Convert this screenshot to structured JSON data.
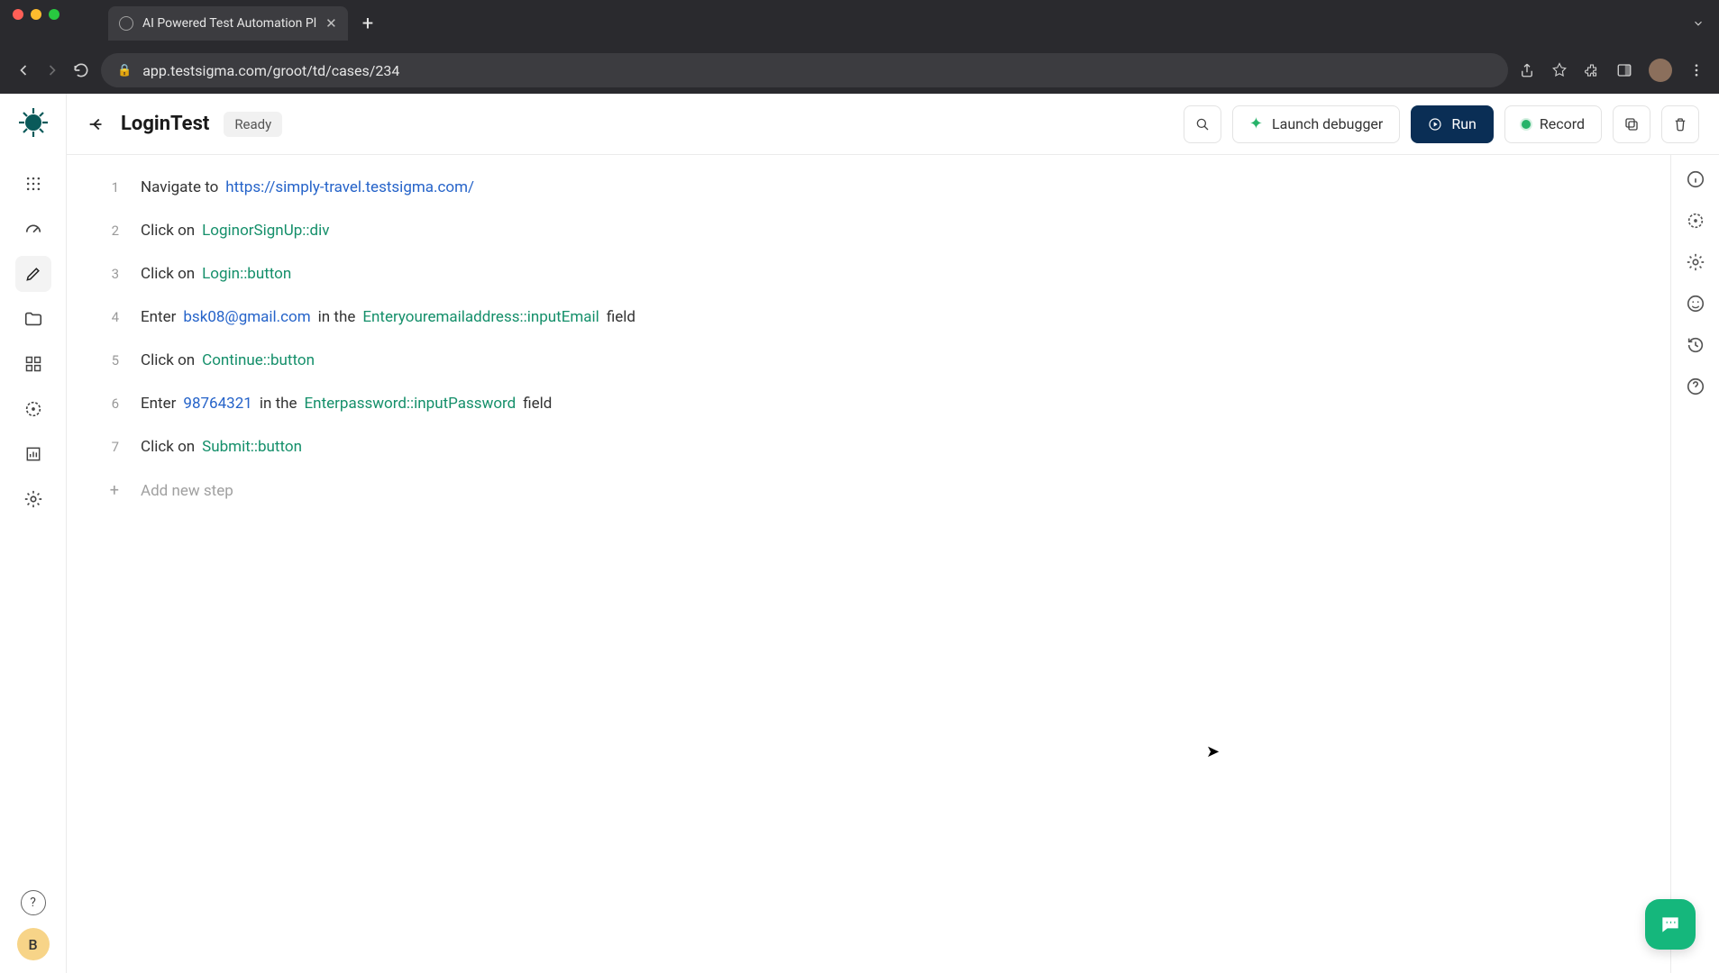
{
  "browser": {
    "tab_title": "AI Powered Test Automation Pl",
    "url": "app.testsigma.com/groot/td/cases/234"
  },
  "header": {
    "title": "LoginTest",
    "status": "Ready",
    "launch_debugger": "Launch debugger",
    "run": "Run",
    "record": "Record"
  },
  "steps": [
    {
      "n": "1",
      "parts": [
        {
          "t": "plain",
          "v": "Navigate to"
        },
        {
          "t": "link",
          "v": "https://simply-travel.testsigma.com/"
        }
      ]
    },
    {
      "n": "2",
      "parts": [
        {
          "t": "plain",
          "v": "Click on"
        },
        {
          "t": "elem",
          "v": "LoginorSignUp::div"
        }
      ]
    },
    {
      "n": "3",
      "parts": [
        {
          "t": "plain",
          "v": "Click on"
        },
        {
          "t": "elem",
          "v": "Login::button"
        }
      ]
    },
    {
      "n": "4",
      "parts": [
        {
          "t": "plain",
          "v": "Enter"
        },
        {
          "t": "link",
          "v": "bsk08@gmail.com"
        },
        {
          "t": "plain",
          "v": "in the"
        },
        {
          "t": "elem",
          "v": "Enteryouremailaddress::inputEmail"
        },
        {
          "t": "plain",
          "v": "field"
        }
      ]
    },
    {
      "n": "5",
      "parts": [
        {
          "t": "plain",
          "v": "Click on"
        },
        {
          "t": "elem",
          "v": "Continue::button"
        }
      ]
    },
    {
      "n": "6",
      "parts": [
        {
          "t": "plain",
          "v": "Enter"
        },
        {
          "t": "link",
          "v": "98764321"
        },
        {
          "t": "plain",
          "v": "in the"
        },
        {
          "t": "elem",
          "v": "Enterpassword::inputPassword"
        },
        {
          "t": "plain",
          "v": "field"
        }
      ]
    },
    {
      "n": "7",
      "parts": [
        {
          "t": "plain",
          "v": "Click on"
        },
        {
          "t": "elem",
          "v": "Submit::button"
        }
      ]
    }
  ],
  "add_step": "Add new step",
  "avatar_letter": "B"
}
